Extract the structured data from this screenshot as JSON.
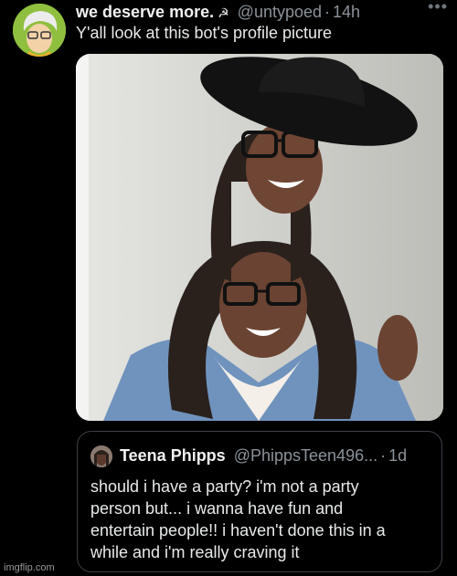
{
  "tweet": {
    "display_name": "we deserve more.",
    "name_emoji": "☭",
    "handle": "@untypoed",
    "separator": "·",
    "time": "14h",
    "more_icon": "more-icon",
    "text": "Y'all look at this bot's profile picture"
  },
  "quoted_tweet": {
    "display_name": "Teena Phipps",
    "handle": "@PhippsTeen496...",
    "separator": "·",
    "time": "1d",
    "text_lines": [
      "should i have a party? i'm not a party",
      "person but... i wanna have fun and",
      "entertain people!! i haven't done this in a",
      "while and i'm really craving it"
    ]
  },
  "watermark": "imgflip.com",
  "colors": {
    "background": "#000000",
    "text": "#e7e9ea",
    "muted": "#8b9299",
    "border": "#3b4046"
  }
}
